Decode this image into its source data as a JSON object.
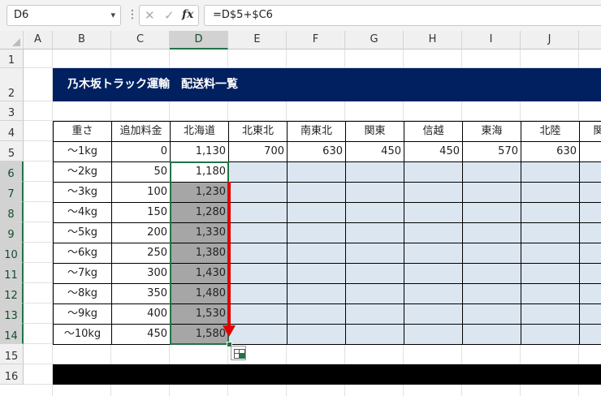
{
  "namebox": {
    "value": "D6"
  },
  "formula": {
    "value": "=D$5+$C6",
    "fx_label": "fx",
    "cancel_glyph": "✕",
    "enter_glyph": "✓",
    "more_glyph": "⋮"
  },
  "columns": [
    "A",
    "B",
    "C",
    "D",
    "E",
    "F",
    "G",
    "H",
    "I",
    "J"
  ],
  "rows": [
    "1",
    "2",
    "3",
    "4",
    "5",
    "6",
    "7",
    "8",
    "9",
    "10",
    "11",
    "12",
    "13",
    "14",
    "15",
    "16"
  ],
  "title": "乃木坂トラック運輸　配送料一覧",
  "table": {
    "headers": [
      "重さ",
      "追加料金",
      "北海道",
      "北東北",
      "南東北",
      "関東",
      "信越",
      "東海",
      "北陸",
      "関"
    ],
    "base_row": [
      "～1kg",
      "0",
      "1,130",
      "700",
      "630",
      "450",
      "450",
      "570",
      "630",
      ""
    ],
    "data_rows": [
      {
        "weight": "～2kg",
        "extra": "50",
        "hokkaido": "1,180"
      },
      {
        "weight": "～3kg",
        "extra": "100",
        "hokkaido": "1,230"
      },
      {
        "weight": "～4kg",
        "extra": "150",
        "hokkaido": "1,280"
      },
      {
        "weight": "～5kg",
        "extra": "200",
        "hokkaido": "1,330"
      },
      {
        "weight": "～6kg",
        "extra": "250",
        "hokkaido": "1,380"
      },
      {
        "weight": "～7kg",
        "extra": "300",
        "hokkaido": "1,430"
      },
      {
        "weight": "～8kg",
        "extra": "350",
        "hokkaido": "1,480"
      },
      {
        "weight": "～9kg",
        "extra": "400",
        "hokkaido": "1,530"
      },
      {
        "weight": "～10kg",
        "extra": "450",
        "hokkaido": "1,580"
      }
    ]
  },
  "colors": {
    "banner": "#002060",
    "selection": "#217346",
    "fill": "#dce6f1",
    "range_highlight": "#a6a6a6",
    "arrow": "#e00000"
  }
}
